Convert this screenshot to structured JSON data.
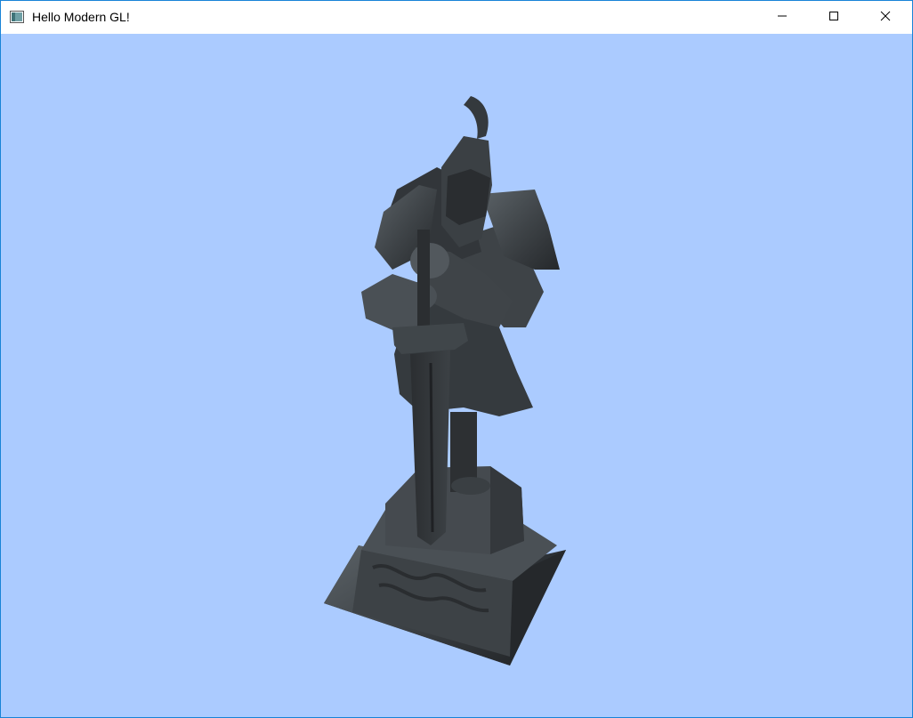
{
  "window": {
    "title": "Hello Modern GL!",
    "icons": {
      "app": "app-window-icon",
      "minimize": "minimize-icon",
      "maximize": "maximize-icon",
      "close": "close-icon"
    }
  },
  "viewport": {
    "background_color": "#abcbff",
    "content": "knight-statue-model"
  },
  "colors": {
    "window_border": "#1883d7",
    "stone_dark": "#2b2e31",
    "stone_mid": "#3f4448",
    "stone_light": "#5b6267"
  }
}
